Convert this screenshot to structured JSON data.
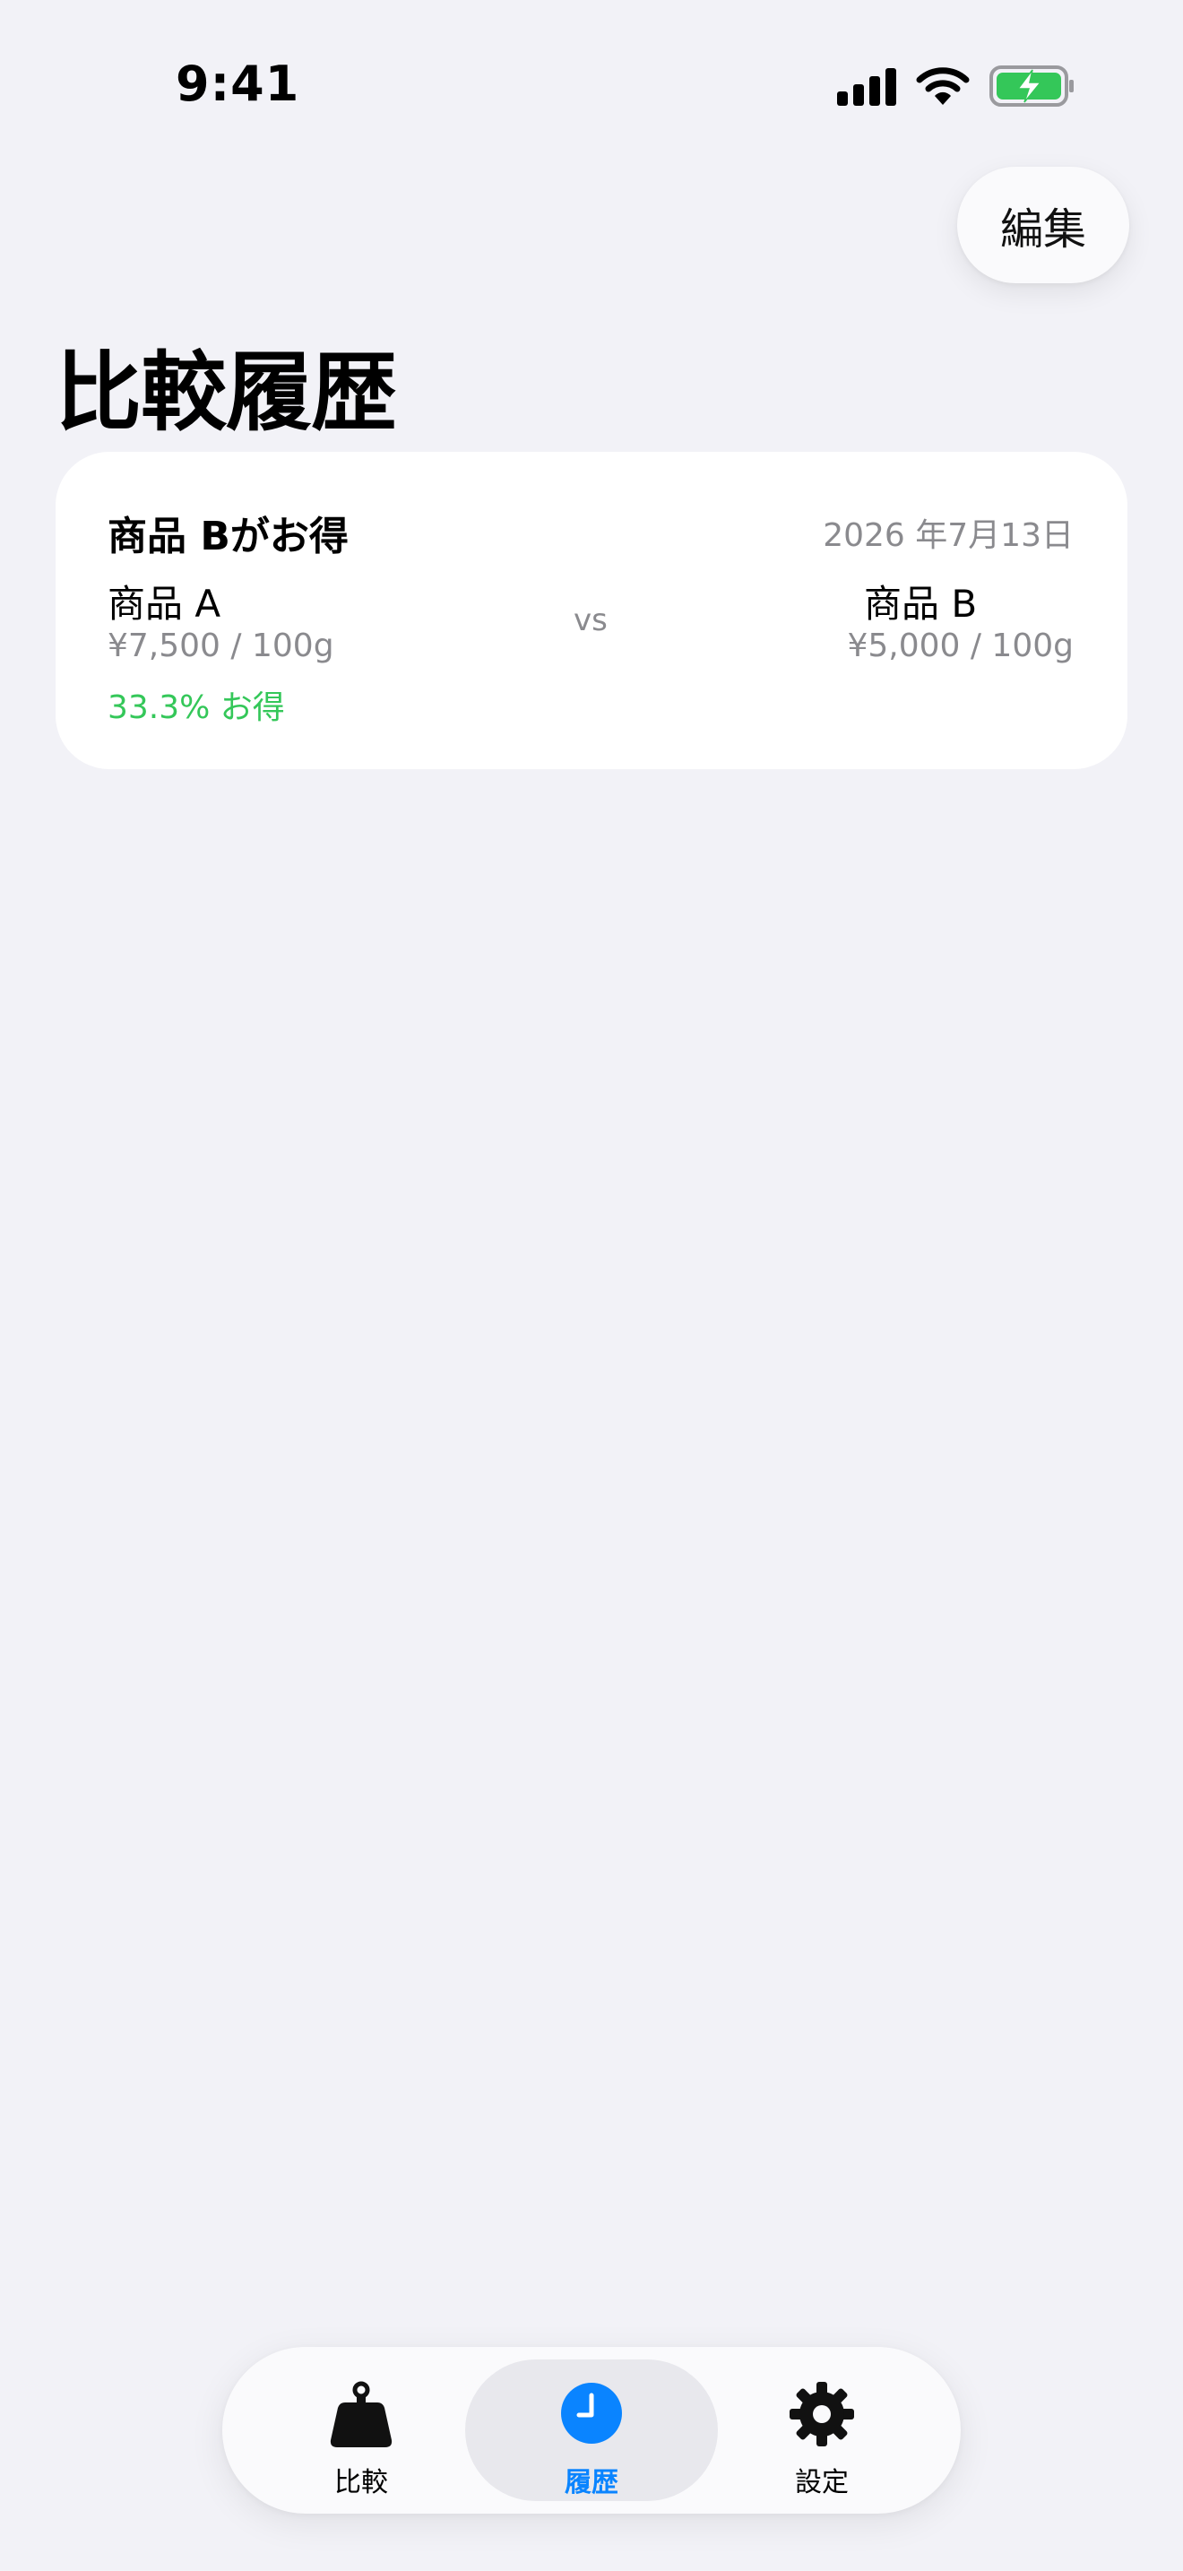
{
  "status_bar": {
    "time": "9:41"
  },
  "header": {
    "edit_label": "編集",
    "title": "比較履歴"
  },
  "history": [
    {
      "verdict": "商品 Bがお得",
      "date": "2026 年7月13日",
      "item_a": {
        "name": "商品 A",
        "unit_price": "¥7,500 / 100g",
        "savings": "33.3% お得"
      },
      "vs": "vs",
      "item_b": {
        "name": "商品 B",
        "unit_price": "¥5,000 / 100g"
      }
    }
  ],
  "tab_bar": {
    "active": 1,
    "tabs": [
      {
        "label": "比較",
        "icon": "weight-icon"
      },
      {
        "label": "履歴",
        "icon": "clock-icon"
      },
      {
        "label": "設定",
        "icon": "gear-icon"
      }
    ]
  },
  "colors": {
    "background": "#f2f2f7",
    "accent": "#0a84ff",
    "savings": "#34c759",
    "battery": "#34c759",
    "secondary_text": "#8a8a8e"
  }
}
